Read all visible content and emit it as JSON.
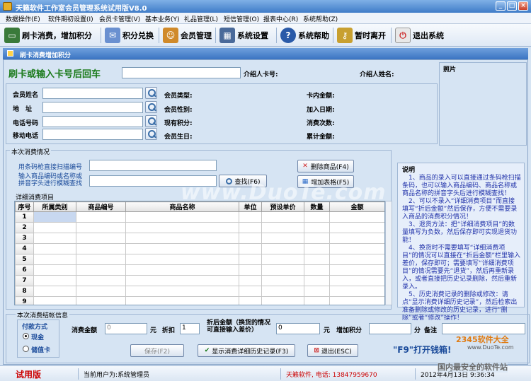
{
  "window": {
    "title": "天籁软件工作室会员管理系统试用版V8.0"
  },
  "menu": [
    "数据操作(E)",
    "软件期初设置(I)",
    "会员卡管理(V)",
    "基本业务(Y)",
    "礼品管理(L)",
    "短信管理(O)",
    "报表中心(R)",
    "系统帮助(Z)"
  ],
  "toolbar": [
    {
      "label": "刷卡消费，增加积分",
      "icon": "card-icon"
    },
    {
      "label": "积分兑换",
      "icon": "envelope-icon"
    },
    {
      "label": "会员管理",
      "icon": "users-icon"
    },
    {
      "label": "系统设置",
      "icon": "settings-icon"
    },
    {
      "label": "系统帮助",
      "icon": "help-icon"
    },
    {
      "label": "暂时离开",
      "icon": "keys-icon"
    },
    {
      "label": "退出系统",
      "icon": "exit-icon"
    }
  ],
  "form": {
    "title": "刷卡消费增加积分",
    "swipe_label": "刷卡或输入卡号后回车",
    "referrer_card_label": "介绍人卡号:",
    "referrer_name_label": "介绍人姓名:",
    "photo_label": "照片",
    "member_name_label": "会员姓名",
    "address_label": "地　址",
    "phone_label": "电话号码",
    "mobile_label": "移动电话",
    "member_type_label": "会员类型:",
    "gender_label": "会员性别:",
    "points_label": "现有积分:",
    "birthday_label": "会员生日:",
    "balance_label": "卡内金额:",
    "join_date_label": "加入日期:",
    "visits_label": "消费次数:",
    "total_label": "累计金额:"
  },
  "consume": {
    "section_label": "本次消费情况",
    "barcode_label": "用条码枪直接扫描编号",
    "search_hint": "输入商品编码或名称或拼音字头进行模糊查找",
    "search_button": "查找(F6)",
    "delete_button": "删除商品(F4)",
    "add_row_button": "增加表格(F5)",
    "detail_label": "详细消费项目",
    "columns": [
      "序号",
      "所属类别",
      "商品编号",
      "商品名称",
      "单位",
      "预设单价",
      "数量",
      "金额"
    ],
    "rows": [
      "1",
      "2",
      "3",
      "4",
      "5",
      "6",
      "7",
      "8",
      "9"
    ]
  },
  "notes": {
    "title": "说明",
    "text": "　1、商品的录入可以直接通过条码枪扫描条码，也可以输入商品编码、商品名称或商品名称的拼音字头后进行模糊查找！\n　2、可以不录入“详细消费项目”而直接填写“折后金额”然后保存，方便不需要录入商品的消费积分情况！\n　3、退货方法：把“详细消费项目”的数量填写为负数，然后保存即可实现退货功能！\n　4、换货时不需要填写“详细消费项目”的情况可以直接在“折后金额”栏里输入差价，保存即可；需要填写“详细消费项目”的情况需要先“退货”，然后再重新录入，或者直接把历史记录删除，然后重新录入。\n　5、历史消费记录的删除或修改：请点“显示消费详细历史记录”，然后检索出准备删除或修改的历史记录，进行“删除”或者“修改”操作！"
  },
  "settle": {
    "section_label": "本次消费结帐信息",
    "pay_label": "付款方式",
    "cash": "现金",
    "stored": "储值卡",
    "amount_label": "消费金额",
    "amount_value": "0",
    "yuan1": "元",
    "discount_label": "折扣",
    "discount_value": "1",
    "after_label": "折后金额（换货的情况可直接输入差价）",
    "after_value": "0",
    "yuan2": "元",
    "points_label": "增加积分",
    "points_unit": "分",
    "remark_label": "备注",
    "save_button": "保存(F2)",
    "history_button": "显示消费详细历史记录(F3)",
    "exit_button": "退出(ESC)",
    "f9_hint": "\"F9\"打开钱箱!"
  },
  "watermark": "www.DuoTe.com",
  "status": {
    "trial": "试用版",
    "user": "当前用户为:系统管理员",
    "company": "天籁软件, 电话: 13847959670",
    "datetime": "2012年4月13日  9:36:34",
    "badge_brand": "2345软件大全",
    "badge_url": "www.DuoTe.com",
    "badge_slogan": "国内最安全的软件站"
  },
  "colors": {
    "title_blue": "#3f7cc8",
    "label_green": "#1a7a1a",
    "notes_blue": "#2233aa",
    "trial_red": "#cc0000",
    "status_red": "#cc0000"
  }
}
